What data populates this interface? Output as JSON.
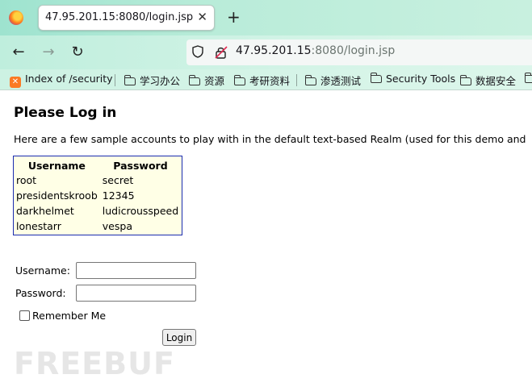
{
  "browser": {
    "tab_title": "47.95.201.15:8080/login.jsp",
    "tab_close": "✕",
    "new_tab": "+",
    "back": "←",
    "forward": "→",
    "reload": "↻",
    "url_host": "47.95.201.15",
    "url_rest": ":8080/login.jsp"
  },
  "bookmarks": [
    {
      "label": "Index of /security",
      "icon": "xampp-icon"
    },
    {
      "label": "学习办公",
      "icon": "folder-icon"
    },
    {
      "label": "资源",
      "icon": "folder-icon"
    },
    {
      "label": "考研资料",
      "icon": "folder-icon"
    },
    {
      "label": "渗透测试",
      "icon": "folder-icon"
    },
    {
      "label": "Security Tools",
      "icon": "folder-icon"
    },
    {
      "label": "数据安全",
      "icon": "folder-icon"
    }
  ],
  "page": {
    "title": "Please Log in",
    "intro": "Here are a few sample accounts to play with in the default text-based Realm (used for this demo and",
    "table": {
      "headers": [
        "Username",
        "Password"
      ],
      "rows": [
        [
          "root",
          "secret"
        ],
        [
          "presidentskroob",
          "12345"
        ],
        [
          "darkhelmet",
          "ludicrousspeed"
        ],
        [
          "lonestarr",
          "vespa"
        ]
      ]
    },
    "form": {
      "username_label": "Username:",
      "password_label": "Password:",
      "remember_label": "Remember Me",
      "submit_label": "Login"
    },
    "watermark": "FREEBUF"
  },
  "colors": {
    "tabbar": "#9ee3cf",
    "table_bg": "#ffffe6",
    "table_border": "#1a2cb0",
    "xampp": "#fb7a24"
  }
}
